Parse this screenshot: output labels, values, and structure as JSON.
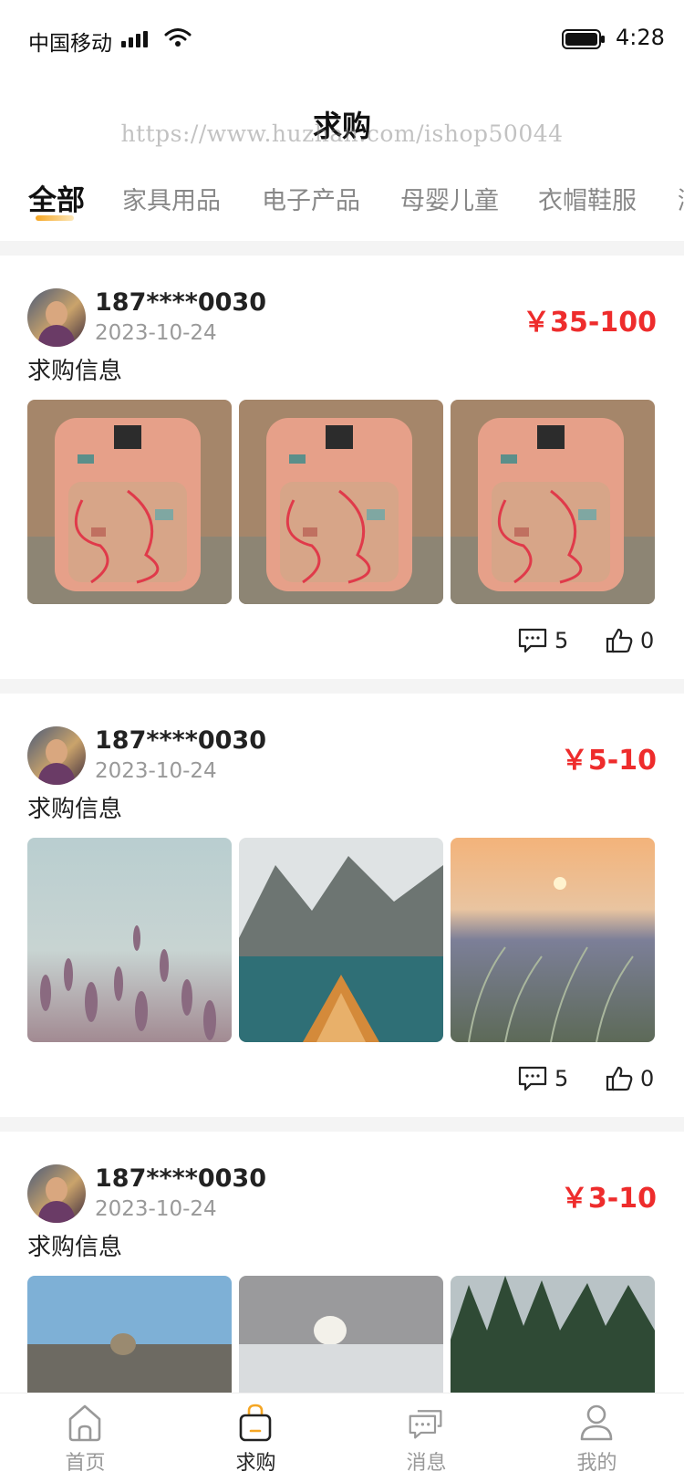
{
  "status_bar": {
    "carrier": "中国移动",
    "time": "4:28"
  },
  "header": {
    "title": "求购",
    "watermark": "https://www.huzhan.com/ishop50044"
  },
  "categories": [
    "全部",
    "家具用品",
    "电子产品",
    "母婴儿童",
    "衣帽鞋服",
    "潮"
  ],
  "active_category": "全部",
  "posts": [
    {
      "user": "187****0030",
      "date": "2023-10-24",
      "price": "￥35-100",
      "description": "求购信息",
      "comments": "5",
      "likes": "0",
      "images": [
        "backpack-photo",
        "backpack-photo",
        "backpack-photo"
      ]
    },
    {
      "user": "187****0030",
      "date": "2023-10-24",
      "price": "￥5-10",
      "description": "求购信息",
      "comments": "5",
      "likes": "0",
      "images": [
        "lavender-field-photo",
        "lake-boat-photo",
        "sunset-meadow-photo"
      ]
    },
    {
      "user": "187****0030",
      "date": "2023-10-24",
      "price": "￥3-10",
      "description": "求购信息",
      "comments": "",
      "likes": "",
      "images": [
        "seal-photo",
        "polar-bear-photo",
        "forest-photo"
      ]
    }
  ],
  "tabbar": [
    {
      "label": "首页",
      "icon": "home-icon",
      "active": false
    },
    {
      "label": "求购",
      "icon": "shopping-bag-icon",
      "active": true
    },
    {
      "label": "消息",
      "icon": "chat-bubbles-icon",
      "active": false
    },
    {
      "label": "我的",
      "icon": "user-icon",
      "active": false
    }
  ],
  "colors": {
    "accent": "#f5a623",
    "price": "#ee2c2c",
    "page_bg": "#f4f4f4"
  }
}
